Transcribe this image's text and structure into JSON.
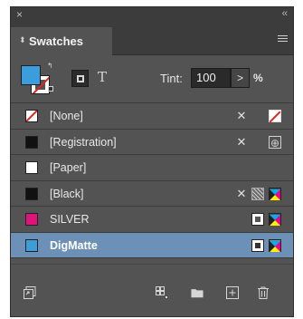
{
  "panel": {
    "close_glyph": "×",
    "collapse_glyph": "‹‹",
    "tab_label": "Swatches",
    "tab_arrows_glyph": "⬍"
  },
  "controls": {
    "swap_glyph": "↰",
    "text_glyph": "T",
    "tint_label": "Tint:",
    "tint_value": "100",
    "tint_arrow": ">",
    "tint_unit": "%"
  },
  "swatches": [
    {
      "name": "[None]",
      "chip": "none",
      "icons": [
        "non-editable",
        "none-swatch"
      ]
    },
    {
      "name": "[Registration]",
      "chip": "#111111",
      "icons": [
        "non-editable",
        "registration"
      ]
    },
    {
      "name": "[Paper]",
      "chip": "#ffffff",
      "icons": []
    },
    {
      "name": "[Black]",
      "chip": "#111111",
      "icons": [
        "non-editable",
        "pattern",
        "cmyk"
      ]
    },
    {
      "name": "SILVER",
      "chip": "#e0137c",
      "icons": [
        "spot",
        "cmyk"
      ]
    },
    {
      "name": "DigMatte",
      "chip": "#3c9ddd",
      "icons": [
        "spot",
        "cmyk"
      ],
      "selected": true
    }
  ],
  "colors": {
    "panel_bg": "#535353",
    "selection": "#6d90b7",
    "fill_blue": "#3c9ddd",
    "none_red": "#e0261b"
  }
}
